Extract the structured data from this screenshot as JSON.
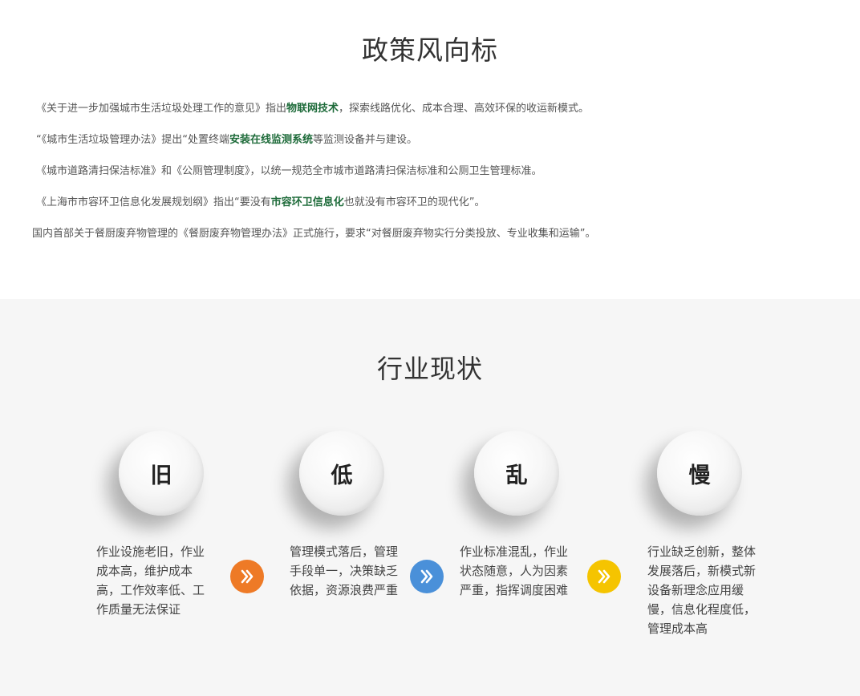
{
  "policy": {
    "title": "政策风向标",
    "lines": [
      {
        "before": "《关于进一步加强城市生活垃圾处理工作的意见》指出",
        "highlight": "物联网技术",
        "after": "，探索线路优化、成本合理、高效环保的收运新模式。"
      },
      {
        "before": "“《城市生活垃圾管理办法》提出“处置终端",
        "highlight": "安装在线监测系统",
        "after": "等监测设备并与建设。"
      },
      {
        "before": "《城市道路清扫保洁标准》和《公厕管理制度》，以统一规范全市城市道路清扫保洁标准和公厕卫生管理标准。",
        "highlight": "",
        "after": ""
      },
      {
        "before": "《上海市市容环卫信息化发展规划纲》指出“要没有",
        "highlight": "市容环卫信息化",
        "after": "也就没有市容环卫的现代化”。"
      },
      {
        "before": "国内首部关于餐厨废弃物管理的《餐厨废弃物管理办法》正式施行，要求“对餐厨废弃物实行分类投放、专业收集和运输”。",
        "highlight": "",
        "after": ""
      }
    ]
  },
  "industry": {
    "title": "行业现状",
    "items": [
      {
        "char": "旧",
        "desc": "作业设施老旧，作业成本高，维护成本高，工作效率低、工作质量无法保证"
      },
      {
        "char": "低",
        "desc": "管理模式落后，管理手段单一，决策缺乏依据，资源浪费严重"
      },
      {
        "char": "乱",
        "desc": "作业标准混乱，作业状态随意，人为因素严重，指挥调度困难"
      },
      {
        "char": "慢",
        "desc": "行业缺乏创新，整体发展落后，新模式新设备新理念应用缓慢，信息化程度低，管理成本高"
      }
    ],
    "arrows": [
      {
        "icon": "double-chevron-right-icon",
        "color": "#ee7a26"
      },
      {
        "icon": "double-chevron-right-icon",
        "color": "#4a90d9"
      },
      {
        "icon": "double-chevron-right-icon",
        "color": "#f5c400"
      }
    ]
  }
}
